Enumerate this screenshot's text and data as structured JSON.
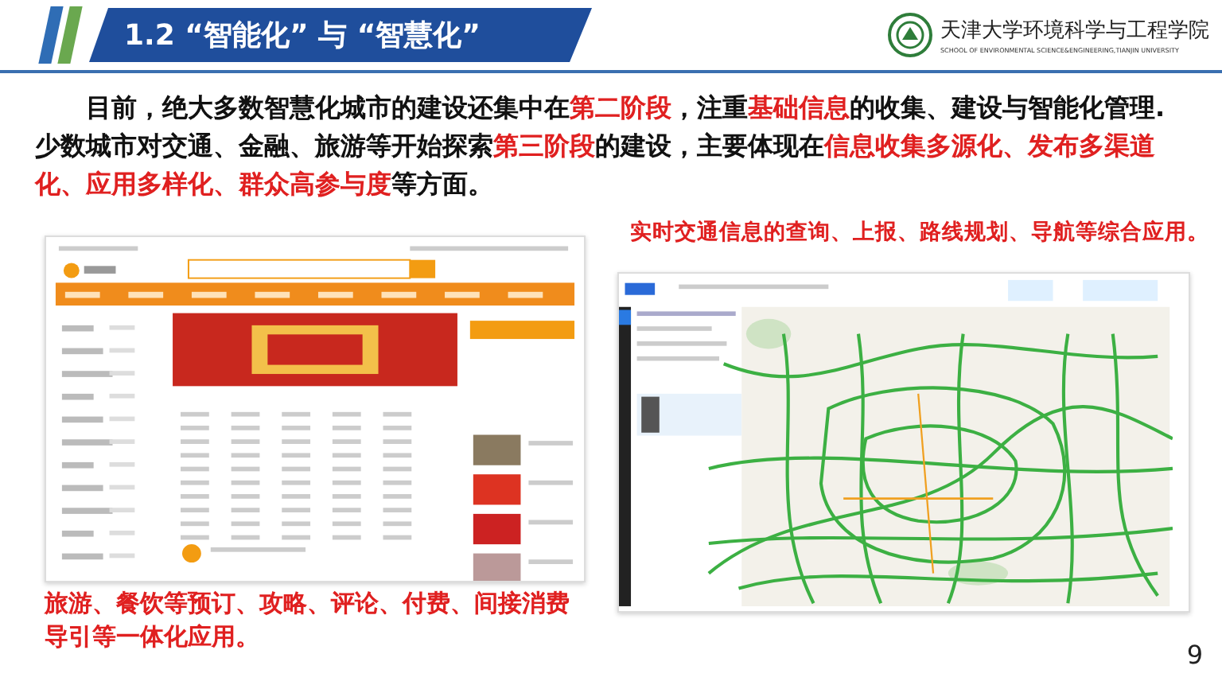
{
  "header": {
    "title": "1.2 “智能化” 与 “智慧化”",
    "school_name": "天津大学环境科学与工程学院",
    "school_name_en": "SCHOOL OF ENVIRONMENTAL SCIENCE&ENGINEERING,TIANJIN UNIVERSITY"
  },
  "paragraph": [
    {
      "text": "目前，绝大多数智慧化城市的建设还集中在",
      "highlight": false
    },
    {
      "text": "第二阶段",
      "highlight": true
    },
    {
      "text": "，注重",
      "highlight": false
    },
    {
      "text": "基础信息",
      "highlight": true
    },
    {
      "text": "的收集、建设与智能化管理. 少数城市对交通、金融、旅游等开始探索",
      "highlight": false
    },
    {
      "text": "第三阶段",
      "highlight": true
    },
    {
      "text": "的建设，主要体现在",
      "highlight": false
    },
    {
      "text": "信息收集多源化、发布多渠道化、应用多样化、群众高参与度",
      "highlight": true
    },
    {
      "text": "等方面。",
      "highlight": false
    }
  ],
  "left_panel": {
    "caption": "旅游、餐饮等预订、攻略、评论、付费、间接消费导引等一体化应用。"
  },
  "right_panel": {
    "caption": "实时交通信息的查询、上报、路线规划、导航等综合应用。"
  },
  "page_number": "9"
}
